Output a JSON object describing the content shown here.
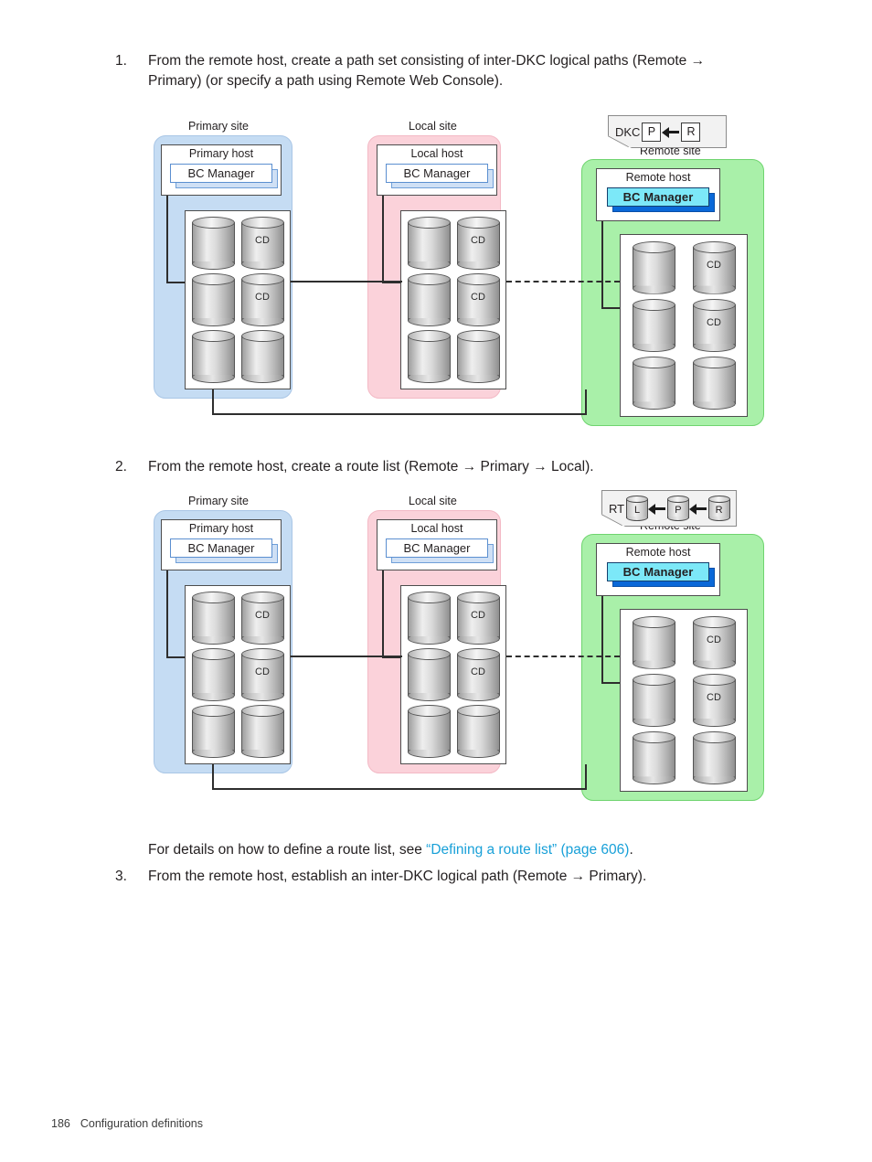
{
  "steps": [
    {
      "number": "1.",
      "text": "From the remote host, create a path set consisting of inter-DKC logical paths (Remote → Primary) (or specify a path using Remote Web Console)."
    },
    {
      "number": "2.",
      "text": "From the remote host, create a route list (Remote → Primary → Local)."
    },
    {
      "number": "3.",
      "text": "From the remote host, establish an inter-DKC logical path (Remote → Primary)."
    }
  ],
  "note": {
    "lead": "For details on how to define a route list, see ",
    "link": "“Defining a route list” (page 606)",
    "tail": ".",
    "link_color": "#18a0d8"
  },
  "footer": {
    "page_number": "186",
    "section": "Configuration definitions"
  },
  "figures": [
    {
      "id": "figure-path-set",
      "sites": [
        {
          "key": "primary",
          "label": "Primary site",
          "host_title": "Primary host",
          "app_label": "BC Manager",
          "highlighted": false,
          "color": "#c5dcf3",
          "disks": [
            {
              "label": ""
            },
            {
              "label": "CD"
            },
            {
              "label": ""
            },
            {
              "label": "CD"
            },
            {
              "label": ""
            },
            {
              "label": ""
            }
          ]
        },
        {
          "key": "local",
          "label": "Local site",
          "host_title": "Local host",
          "app_label": "BC Manager",
          "highlighted": false,
          "color": "#fbd2da",
          "disks": [
            {
              "label": ""
            },
            {
              "label": "CD"
            },
            {
              "label": ""
            },
            {
              "label": "CD"
            },
            {
              "label": ""
            },
            {
              "label": ""
            }
          ]
        },
        {
          "key": "remote",
          "label": "Remote site",
          "host_title": "Remote host",
          "app_label": "BC Manager",
          "highlighted": true,
          "color": "#a9f0a9",
          "disks": [
            {
              "label": ""
            },
            {
              "label": "CD"
            },
            {
              "label": ""
            },
            {
              "label": "CD"
            },
            {
              "label": ""
            },
            {
              "label": ""
            }
          ]
        }
      ],
      "callout": {
        "kind": "boxes",
        "tag": "DKC",
        "nodes": [
          {
            "label": "P"
          },
          {
            "label": "R"
          }
        ]
      }
    },
    {
      "id": "figure-route-list",
      "sites": [
        {
          "key": "primary",
          "label": "Primary site",
          "host_title": "Primary host",
          "app_label": "BC Manager",
          "highlighted": false,
          "color": "#c5dcf3",
          "disks": [
            {
              "label": ""
            },
            {
              "label": "CD"
            },
            {
              "label": ""
            },
            {
              "label": "CD"
            },
            {
              "label": ""
            },
            {
              "label": ""
            }
          ]
        },
        {
          "key": "local",
          "label": "Local site",
          "host_title": "Local host",
          "app_label": "BC Manager",
          "highlighted": false,
          "color": "#fbd2da",
          "disks": [
            {
              "label": ""
            },
            {
              "label": "CD"
            },
            {
              "label": ""
            },
            {
              "label": "CD"
            },
            {
              "label": ""
            },
            {
              "label": ""
            }
          ]
        },
        {
          "key": "remote",
          "label": "Remote site",
          "host_title": "Remote host",
          "app_label": "BC Manager",
          "highlighted": true,
          "color": "#a9f0a9",
          "disks": [
            {
              "label": ""
            },
            {
              "label": "CD"
            },
            {
              "label": ""
            },
            {
              "label": "CD"
            },
            {
              "label": ""
            },
            {
              "label": ""
            }
          ]
        }
      ],
      "callout": {
        "kind": "cylinders",
        "tag": "RT",
        "nodes": [
          {
            "label": "L"
          },
          {
            "label": "P"
          },
          {
            "label": "R"
          }
        ]
      }
    }
  ]
}
